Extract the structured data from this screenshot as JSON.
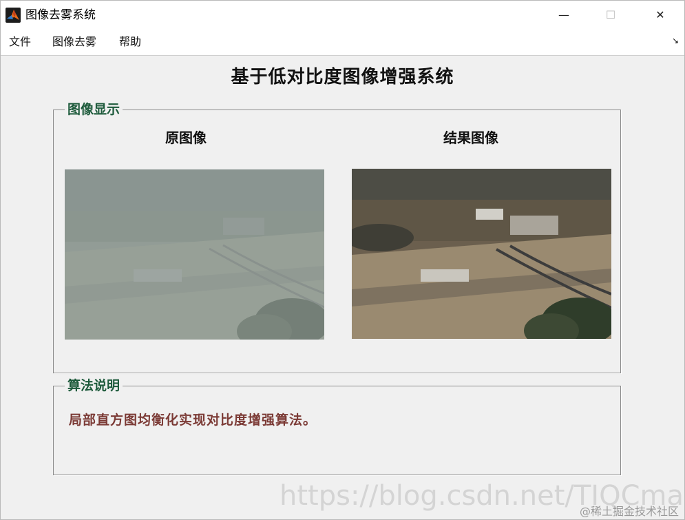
{
  "window": {
    "title": "图像去雾系统",
    "controls": {
      "minimize": "—",
      "maximize": "☐",
      "close": "✕"
    }
  },
  "menu": {
    "items": [
      "文件",
      "图像去雾",
      "帮助"
    ],
    "dock_glyph": "↘"
  },
  "main_title": "基于低对比度图像增强系统",
  "image_panel": {
    "legend": "图像显示",
    "original_label": "原图像",
    "result_label": "结果图像"
  },
  "algo_panel": {
    "legend": "算法说明",
    "description": "局部直方图均衡化实现对比度增强算法。"
  },
  "colors": {
    "legend_green": "#1e5b3c",
    "description_red": "#7b3a35"
  },
  "watermark": {
    "url": "https://blog.csdn.net/TIQCmatlab",
    "site": "@稀土掘金技术社区"
  }
}
